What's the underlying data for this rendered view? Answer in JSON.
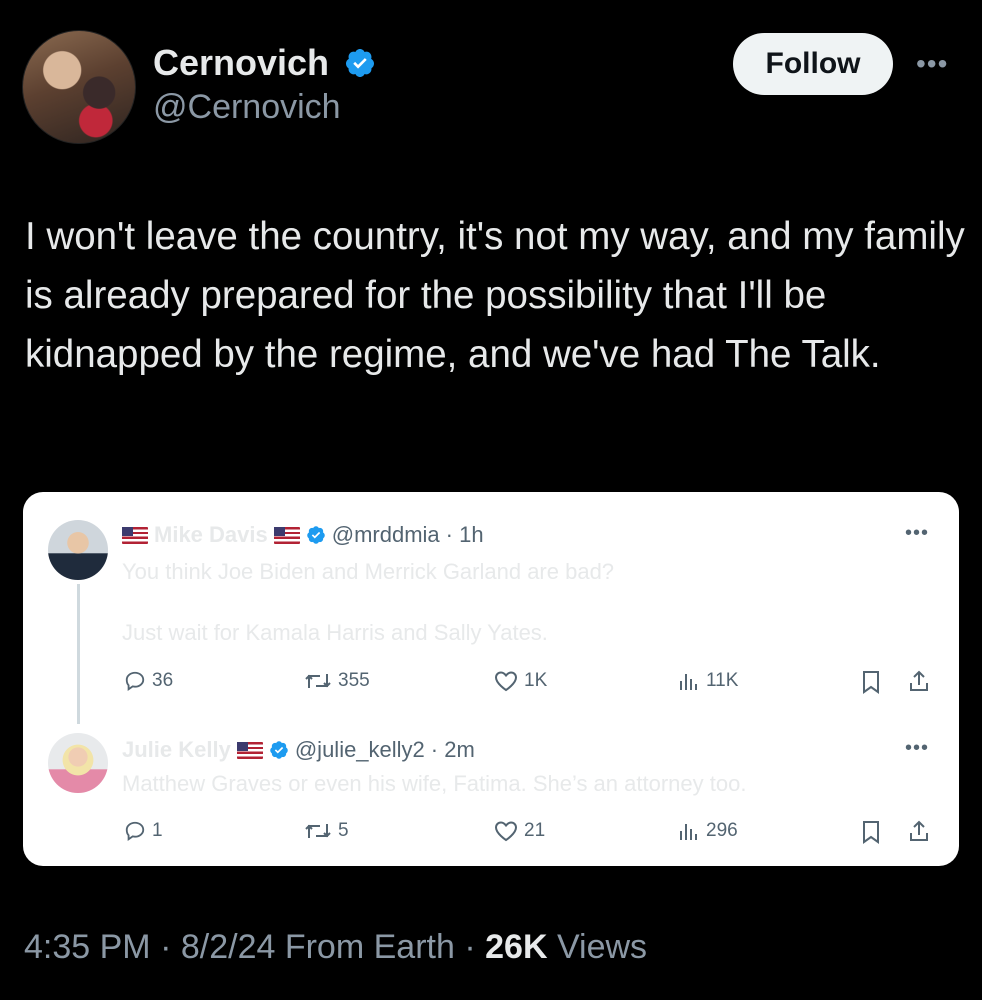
{
  "author": {
    "display_name": "Cernovich",
    "handle": "@Cernovich",
    "verified": true
  },
  "follow_label": "Follow",
  "more_glyph": "•••",
  "tweet_text": "I won't leave the country, it's not my way, and my family is already prepared for the possibility that I'll be kidnapped by the regime, and we've had The Talk.",
  "quoted": {
    "first": {
      "display_name": "Mike Davis",
      "handle": "@mrddmia",
      "time": "· 1h",
      "text_line1": "You think Joe Biden and Merrick Garland are bad?",
      "text_line2": "Just wait for Kamala Harris and Sally Yates.",
      "metrics": {
        "replies": "36",
        "reposts": "355",
        "likes": "1K",
        "views": "11K"
      }
    },
    "second": {
      "display_name": "Julie Kelly",
      "handle": "@julie_kelly2",
      "time": "· 2m",
      "text": "Matthew Graves or even his wife, Fatima. She’s an attorney too.",
      "metrics": {
        "replies": "1",
        "reposts": "5",
        "likes": "21",
        "views": "296"
      }
    }
  },
  "footer": {
    "time": "4:35 PM",
    "date": "8/2/24",
    "source": "From Earth",
    "views_count": "26K",
    "views_label": "Views"
  },
  "colors": {
    "background": "#000000",
    "text_primary": "#e7e9ea",
    "text_secondary": "#8b98a5",
    "verified_blue": "#1d9bf0",
    "card_background": "#ffffff"
  },
  "icons": [
    "verified-badge-icon",
    "more-icon",
    "reply-icon",
    "repost-icon",
    "like-icon",
    "views-icon",
    "bookmark-icon",
    "share-icon",
    "us-flag-icon"
  ]
}
